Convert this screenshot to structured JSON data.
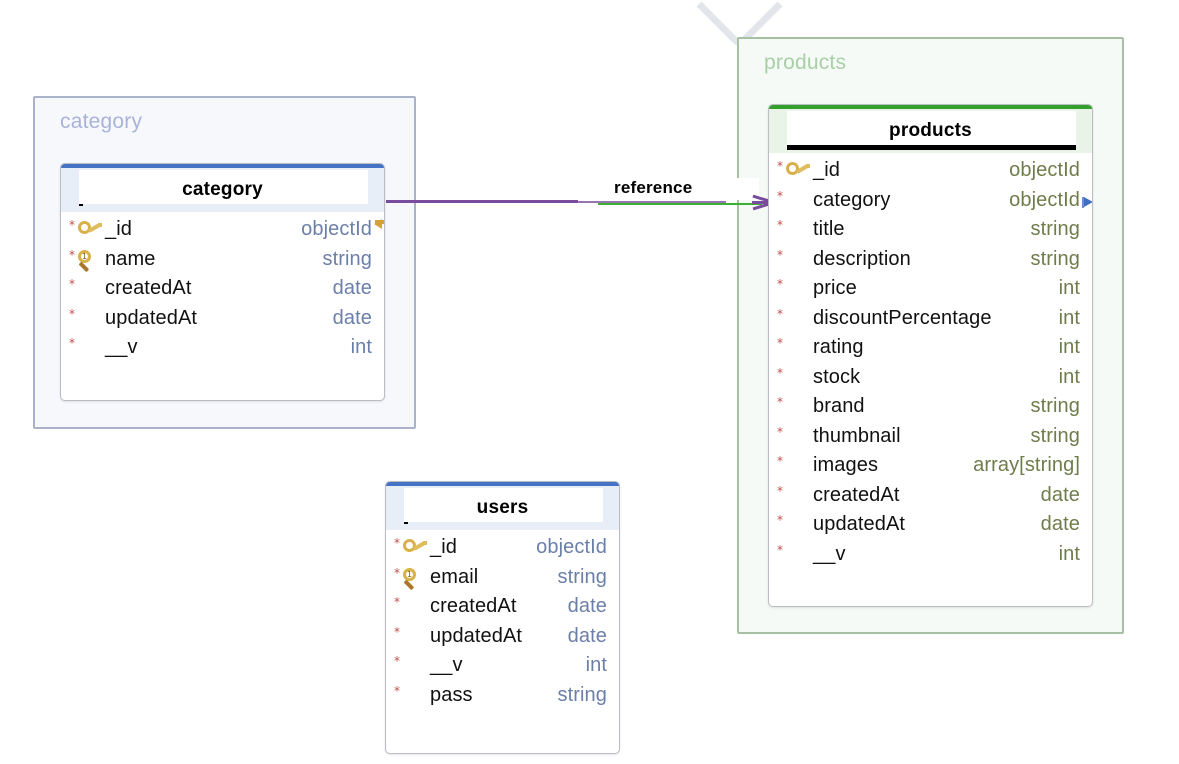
{
  "diagram": {
    "type": "entity-relationship-diagram",
    "background": "#ffffff",
    "groups": [
      {
        "id": "category",
        "label": "category",
        "accent": "#aab3c9",
        "fill": "#f7f8fc",
        "label_color": "#a9b3d8"
      },
      {
        "id": "products",
        "label": "products",
        "accent": "#a6c0a3",
        "fill": "#f6faf6",
        "label_color": "#a8cfa6"
      }
    ],
    "tables": [
      {
        "id": "category",
        "title": "category",
        "accent": "#4472c4",
        "header_fill": "#e8eef8",
        "type_color": "#6b7fa8",
        "editing": true,
        "fields": [
          {
            "required": "*",
            "key": "primary-key",
            "name": "_id",
            "type": "objectId",
            "marker": "hook"
          },
          {
            "required": "*",
            "key": "unique-key",
            "key_badge": "1",
            "name": "name",
            "type": "string",
            "marker": "none"
          },
          {
            "required": "*",
            "key": "none",
            "name": "createdAt",
            "type": "date",
            "marker": "none"
          },
          {
            "required": "*",
            "key": "none",
            "name": "updatedAt",
            "type": "date",
            "marker": "none"
          },
          {
            "required": "*",
            "key": "none",
            "name": "__v",
            "type": "int",
            "marker": "none"
          }
        ]
      },
      {
        "id": "products",
        "title": "products",
        "accent": "#34a02c",
        "header_fill": "#e9f3e7",
        "type_color": "#6f7c4c",
        "editing": true,
        "fields": [
          {
            "required": "*",
            "key": "primary-key",
            "name": "_id",
            "type": "objectId",
            "marker": "none"
          },
          {
            "required": "*",
            "key": "none",
            "name": "category",
            "type": "objectId",
            "marker": "foreign-key-arrow"
          },
          {
            "required": "*",
            "key": "none",
            "name": "title",
            "type": "string",
            "marker": "none"
          },
          {
            "required": "*",
            "key": "none",
            "name": "description",
            "type": "string",
            "marker": "none"
          },
          {
            "required": "*",
            "key": "none",
            "name": "price",
            "type": "int",
            "marker": "none"
          },
          {
            "required": "*",
            "key": "none",
            "name": "discountPercentage",
            "type": "int",
            "marker": "none"
          },
          {
            "required": "*",
            "key": "none",
            "name": "rating",
            "type": "int",
            "marker": "none"
          },
          {
            "required": "*",
            "key": "none",
            "name": "stock",
            "type": "int",
            "marker": "none"
          },
          {
            "required": "*",
            "key": "none",
            "name": "brand",
            "type": "string",
            "marker": "none"
          },
          {
            "required": "*",
            "key": "none",
            "name": "thumbnail",
            "type": "string",
            "marker": "none"
          },
          {
            "required": "*",
            "key": "none",
            "name": "images",
            "type": "array[string]",
            "marker": "none"
          },
          {
            "required": "*",
            "key": "none",
            "name": "createdAt",
            "type": "date",
            "marker": "none"
          },
          {
            "required": "*",
            "key": "none",
            "name": "updatedAt",
            "type": "date",
            "marker": "none"
          },
          {
            "required": "*",
            "key": "none",
            "name": "__v",
            "type": "int",
            "marker": "none"
          }
        ]
      },
      {
        "id": "users",
        "title": "users",
        "accent": "#4472c4",
        "header_fill": "#e8eef8",
        "type_color": "#6b7fa8",
        "editing": true,
        "fields": [
          {
            "required": "*",
            "key": "primary-key",
            "name": "_id",
            "type": "objectId",
            "marker": "none"
          },
          {
            "required": "*",
            "key": "unique-key",
            "key_badge": "1",
            "name": "email",
            "type": "string",
            "marker": "none"
          },
          {
            "required": "*",
            "key": "none",
            "name": "createdAt",
            "type": "date",
            "marker": "none"
          },
          {
            "required": "*",
            "key": "none",
            "name": "updatedAt",
            "type": "date",
            "marker": "none"
          },
          {
            "required": "*",
            "key": "none",
            "name": "__v",
            "type": "int",
            "marker": "none"
          },
          {
            "required": "*",
            "key": "none",
            "name": "pass",
            "type": "string",
            "marker": "none"
          }
        ]
      }
    ],
    "relationships": [
      {
        "id": "category-products",
        "label": "reference",
        "from": "category",
        "to": "products",
        "from_field": "_id",
        "to_field": "category",
        "line_colors": [
          "#7a4c9e",
          "#3cb034"
        ],
        "to_cardinality": "many"
      }
    ]
  }
}
